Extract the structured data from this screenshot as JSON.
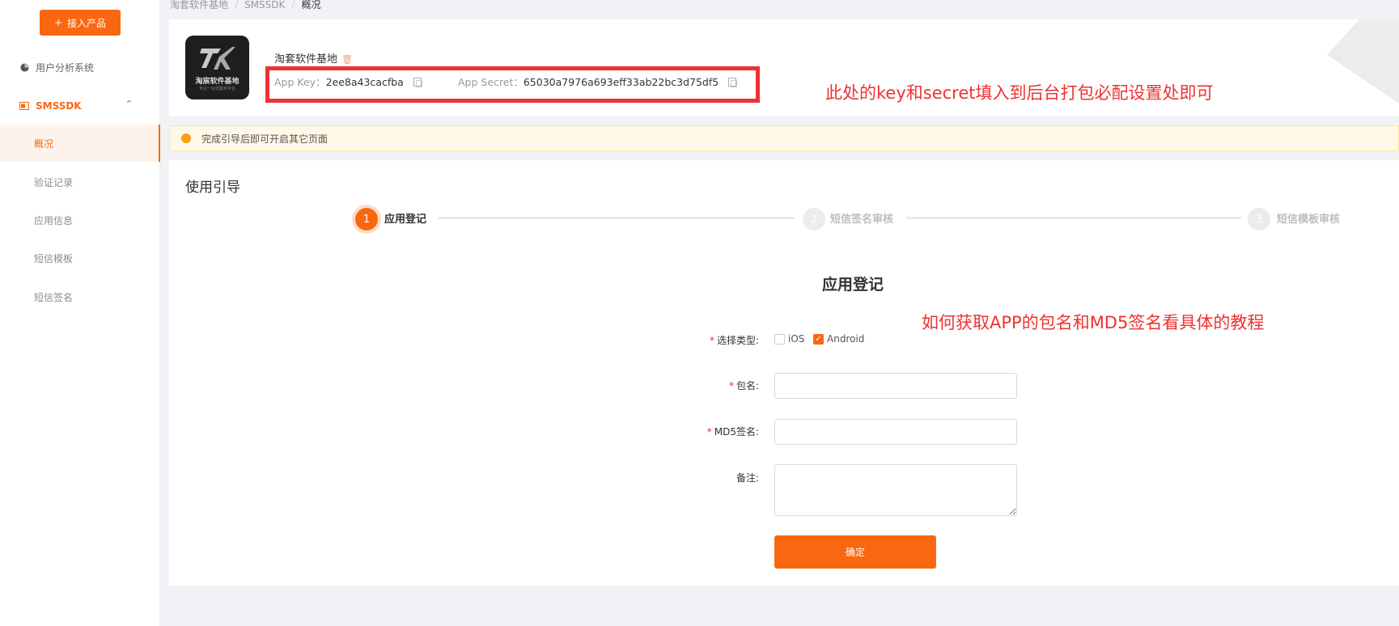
{
  "sidebar": {
    "add_button": "接入产品",
    "add_icon": "plus-icon",
    "items": [
      {
        "label": "用户分析系统",
        "icon": "pie-chart-icon"
      },
      {
        "label": "SMSSDK",
        "icon": "sms-icon",
        "expanded": true
      }
    ],
    "sub_items": [
      {
        "label": "概况",
        "active": true
      },
      {
        "label": "验证记录"
      },
      {
        "label": "应用信息"
      },
      {
        "label": "短信模板"
      },
      {
        "label": "短信签名"
      }
    ]
  },
  "breadcrumb": [
    "淘套软件基地",
    "SMSSDK",
    "概况"
  ],
  "app": {
    "logo_title": "淘宸软件基地",
    "logo_subtitle": "专业一站式服务平台",
    "name": "淘套软件基地",
    "key_label": "App Key：",
    "key_value": "2ee8a43cacfba",
    "secret_label": "App Secret：",
    "secret_value": "65030a7976a693eff33ab22bc3d75df5"
  },
  "annotations": {
    "keys_note": "此处的key和secret填入到后台打包必配设置处即可",
    "md5_note": "如何获取APP的包名和MD5签名看具体的教程"
  },
  "notice": "完成引导后即可开启其它页面",
  "guide": {
    "title": "使用引导",
    "steps": [
      {
        "num": "1",
        "label": "应用登记",
        "active": true
      },
      {
        "num": "2",
        "label": "短信签名审核"
      },
      {
        "num": "3",
        "label": "短信模板审核"
      }
    ]
  },
  "form": {
    "title": "应用登记",
    "type_label": "选择类型:",
    "options": [
      {
        "label": "iOS",
        "checked": false
      },
      {
        "label": "Android",
        "checked": true
      }
    ],
    "package_label": "包名:",
    "package_value": "",
    "md5_label": "MD5签名:",
    "md5_value": "",
    "note_label": "备注:",
    "note_value": "",
    "submit": "确定"
  },
  "colors": {
    "accent": "#f96810",
    "annotation_red": "#ee3131",
    "notice_bg": "#fff8e6"
  }
}
